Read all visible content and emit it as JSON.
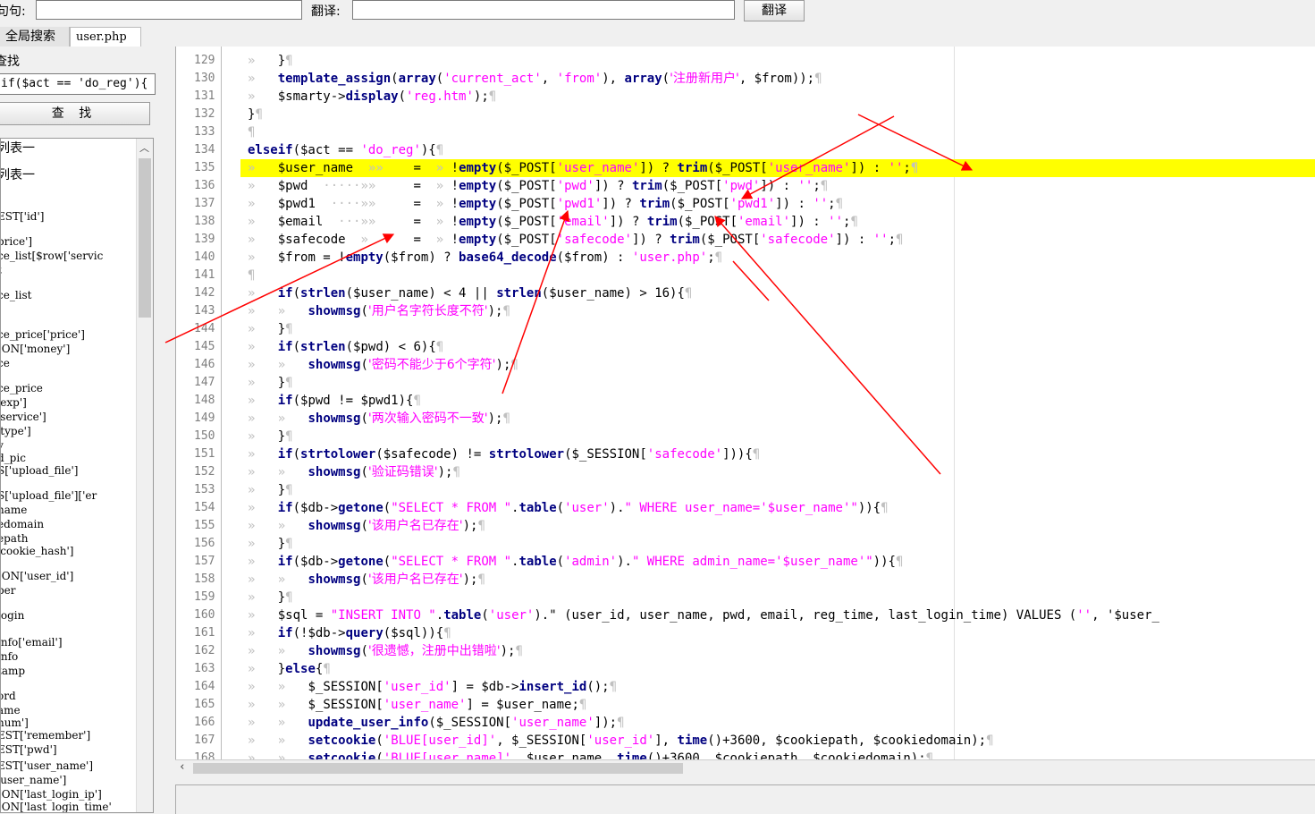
{
  "toolbar": {
    "sentence_label": "句句:",
    "translate_label": "翻译:",
    "translate_button": "翻译"
  },
  "tabs": [
    {
      "label": "全局搜索"
    },
    {
      "label": "user.php"
    }
  ],
  "search": {
    "title": "查找",
    "query": "if($act == 'do_reg'){",
    "find_button": "查 找"
  },
  "list_items": [
    "列表一",
    "列表一",
    "EST['id']",
    "price']",
    "ce_list[$row['servic",
    "t",
    "ce_list",
    "ce_price['price']",
    "ION['money']",
    "ce",
    "ce_price",
    "'exp']",
    "'service']",
    "'type']",
    "y",
    "d_pic",
    "S['upload_file']",
    "S['upload_file']['er",
    "name",
    "edomain",
    "epath",
    "'cookie_hash']",
    "ION['user_id']",
    "per",
    "login",
    "info['email']",
    "info",
    "tamp",
    "ord",
    "ame",
    "num']",
    "EST['remember']",
    "EST['pwd']",
    "EST['user_name']",
    "'user_name']",
    "ION['last_login_ip']",
    "ION['last_login_time'"
  ],
  "editor": {
    "line_numbers": [
      "129",
      "130",
      "131",
      "132",
      "133",
      "134",
      "135",
      "136",
      "137",
      "138",
      "139",
      "140",
      "141",
      "142",
      "143",
      "144",
      "145",
      "146",
      "147",
      "148",
      "149",
      "150",
      "151",
      "152",
      "153",
      "154",
      "155",
      "156",
      "157",
      "158",
      "159",
      "160",
      "161",
      "162",
      "163",
      "164",
      "165",
      "166",
      "167",
      "168"
    ],
    "lines": [
      "»   }¶",
      "»   template_assign(array('current_act', 'from'), array('注册新用户', $from));¶",
      "»   $smarty->display('reg.htm');¶",
      "}¶",
      "¶",
      "elseif($act == 'do_reg'){¶",
      "»   $user_name  »»    =  » !empty($_POST['user_name']) ? trim($_POST['user_name']) : '';¶",
      "»   $pwd  ·····»»     =  » !empty($_POST['pwd']) ? trim($_POST['pwd']) : '';¶",
      "»   $pwd1  ····»»     =  » !empty($_POST['pwd1']) ? trim($_POST['pwd1']) : '';¶",
      "»   $email  ···»»     =  » !empty($_POST['email']) ? trim($_POST['email']) : '';¶",
      "»   $safecode  »      =  » !empty($_POST['safecode']) ? trim($_POST['safecode']) : '';¶",
      "»   $from = !empty($from) ? base64_decode($from) : 'user.php';¶",
      "¶",
      "»   if(strlen($user_name) < 4 || strlen($user_name) > 16){¶",
      "»   »   showmsg('用户名字符长度不符');¶",
      "»   }¶",
      "»   if(strlen($pwd) < 6){¶",
      "»   »   showmsg('密码不能少于6个字符');¶",
      "»   }¶",
      "»   if($pwd != $pwd1){¶",
      "»   »   showmsg('两次输入密码不一致');¶",
      "»   }¶",
      "»   if(strtolower($safecode) != strtolower($_SESSION['safecode'])){¶",
      "»   »   showmsg('验证码错误');¶",
      "»   }¶",
      "»   if($db->getone(\"SELECT * FROM \".table('user').\" WHERE user_name='$user_name'\")){¶",
      "»   »   showmsg('该用户名已存在');¶",
      "»   }¶",
      "»   if($db->getone(\"SELECT * FROM \".table('admin').\" WHERE admin_name='$user_name'\")){¶",
      "»   »   showmsg('该用户名已存在');¶",
      "»   }¶",
      "»   $sql = \"INSERT INTO \".table('user').\" (user_id, user_name, pwd, email, reg_time, last_login_time) VALUES ('', '$user_",
      "»   if(!$db->query($sql)){¶",
      "»   »   showmsg('很遗憾，注册中出错啦');¶",
      "»   }else{¶",
      "»   »   $_SESSION['user_id'] = $db->insert_id();¶",
      "»   »   $_SESSION['user_name'] = $user_name;¶",
      "»   »   update_user_info($_SESSION['user_name']);¶",
      "»   »   setcookie('BLUE[user_id]', $_SESSION['user_id'], time()+3600, $cookiepath, $cookiedomain);¶",
      "»   »   setcookie('BLUE[user_name]', $user_name, time()+3600, $cookiepath, $cookiedomain);¶"
    ],
    "highlight_line_index": 6
  },
  "colors": {
    "keyword": "#000080",
    "string": "#ff00ff",
    "highlight": "#ffff00",
    "annotation": "#ff0000",
    "whitespace_mark": "#c0c0c0",
    "line_number": "#808080"
  },
  "icons": {
    "list_scroll_up": "chevron-up-icon",
    "h_scroll_left": "chevron-left-icon"
  }
}
